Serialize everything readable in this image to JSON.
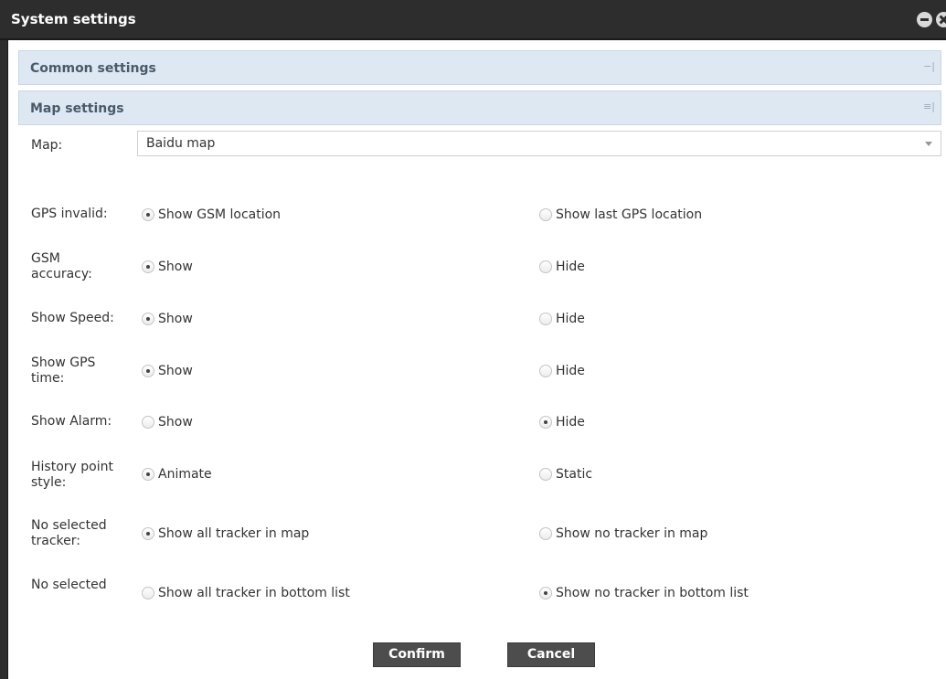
{
  "window": {
    "title": "System settings"
  },
  "sections": {
    "common": {
      "label": "Common settings"
    },
    "map": {
      "label": "Map settings"
    }
  },
  "form": {
    "map": {
      "label": "Map:",
      "value": "Baidu map"
    },
    "rows": [
      {
        "label": "GPS invalid:",
        "option1": "Show GSM location",
        "option2": "Show last GPS location",
        "selected": 1
      },
      {
        "label": "GSM accuracy:",
        "option1": "Show",
        "option2": "Hide",
        "selected": 1
      },
      {
        "label": "Show Speed:",
        "option1": "Show",
        "option2": "Hide",
        "selected": 1
      },
      {
        "label": "Show GPS time:",
        "option1": "Show",
        "option2": "Hide",
        "selected": 1
      },
      {
        "label": "Show Alarm:",
        "option1": "Show",
        "option2": "Hide",
        "selected": 2
      },
      {
        "label": "History point style:",
        "option1": "Animate",
        "option2": "Static",
        "selected": 1
      },
      {
        "label": "No selected tracker:",
        "option1": "Show all tracker in map",
        "option2": "Show no tracker in map",
        "selected": 1
      },
      {
        "label": "No selected",
        "option1": "Show all tracker in bottom list",
        "option2": "Show no tracker in bottom list",
        "selected": 2
      }
    ]
  },
  "buttons": {
    "confirm": "Confirm",
    "cancel": "Cancel"
  },
  "icons": {
    "minimize": "minimize-icon",
    "close": "close-icon",
    "collapse": "collapse-icon",
    "expand": "expand-icon",
    "dropdown": "chevron-down-icon"
  }
}
